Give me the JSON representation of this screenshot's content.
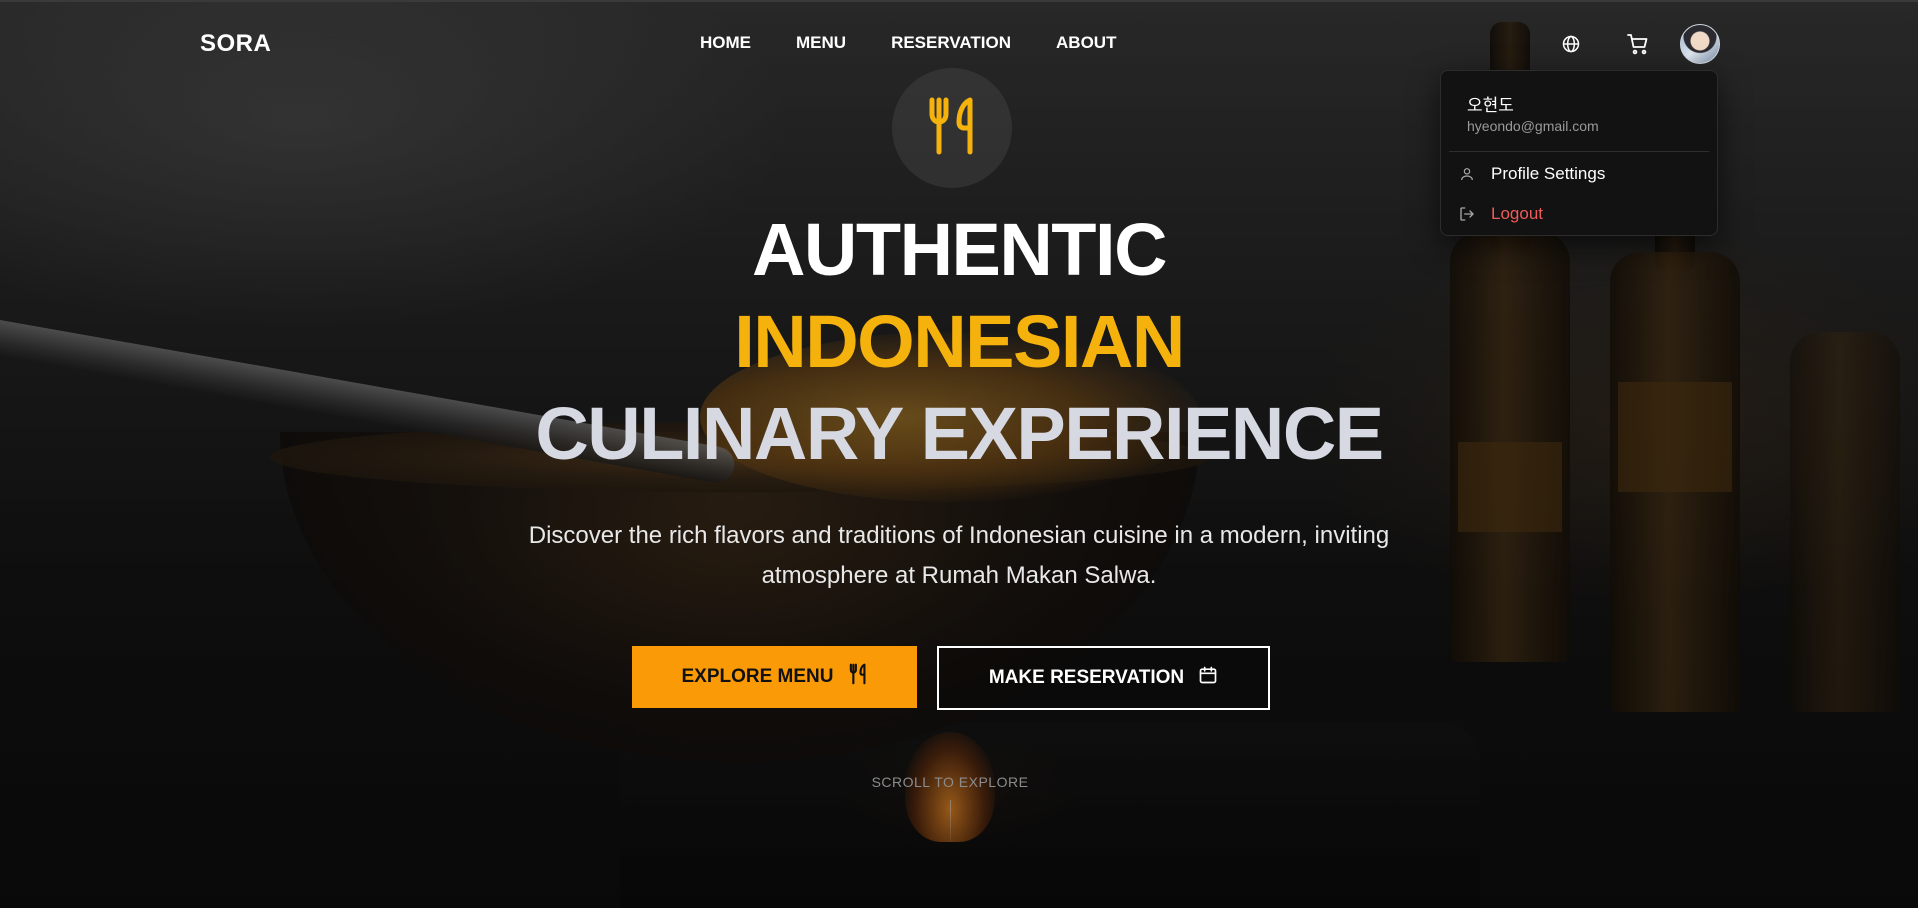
{
  "brand": {
    "logo_text": "SORA",
    "accent_color": "#f5b20c",
    "button_color": "#fa9a06",
    "logout_color": "#ef5a5a"
  },
  "nav": {
    "links": [
      {
        "label": "HOME"
      },
      {
        "label": "MENU"
      },
      {
        "label": "RESERVATION"
      },
      {
        "label": "ABOUT"
      }
    ],
    "icons": [
      "globe-icon",
      "cart-icon",
      "avatar"
    ]
  },
  "user_menu": {
    "name": "오현도",
    "email": "hyeondo@gmail.com",
    "items": [
      {
        "label": "Profile Settings",
        "icon": "user-icon"
      },
      {
        "label": "Logout",
        "icon": "logout-icon"
      }
    ]
  },
  "hero": {
    "badge_icon": "utensils-icon",
    "title_line1": "AUTHENTIC",
    "title_line2": "INDONESIAN",
    "title_line3": "CULINARY EXPERIENCE",
    "description": "Discover the rich flavors and traditions of Indonesian cuisine in a modern, inviting atmosphere at Rumah Makan Salwa.",
    "primary_button": {
      "label": "EXPLORE MENU",
      "icon": "utensils-icon"
    },
    "secondary_button": {
      "label": "MAKE RESERVATION",
      "icon": "calendar-icon"
    },
    "scroll_hint": "SCROLL TO EXPLORE"
  }
}
